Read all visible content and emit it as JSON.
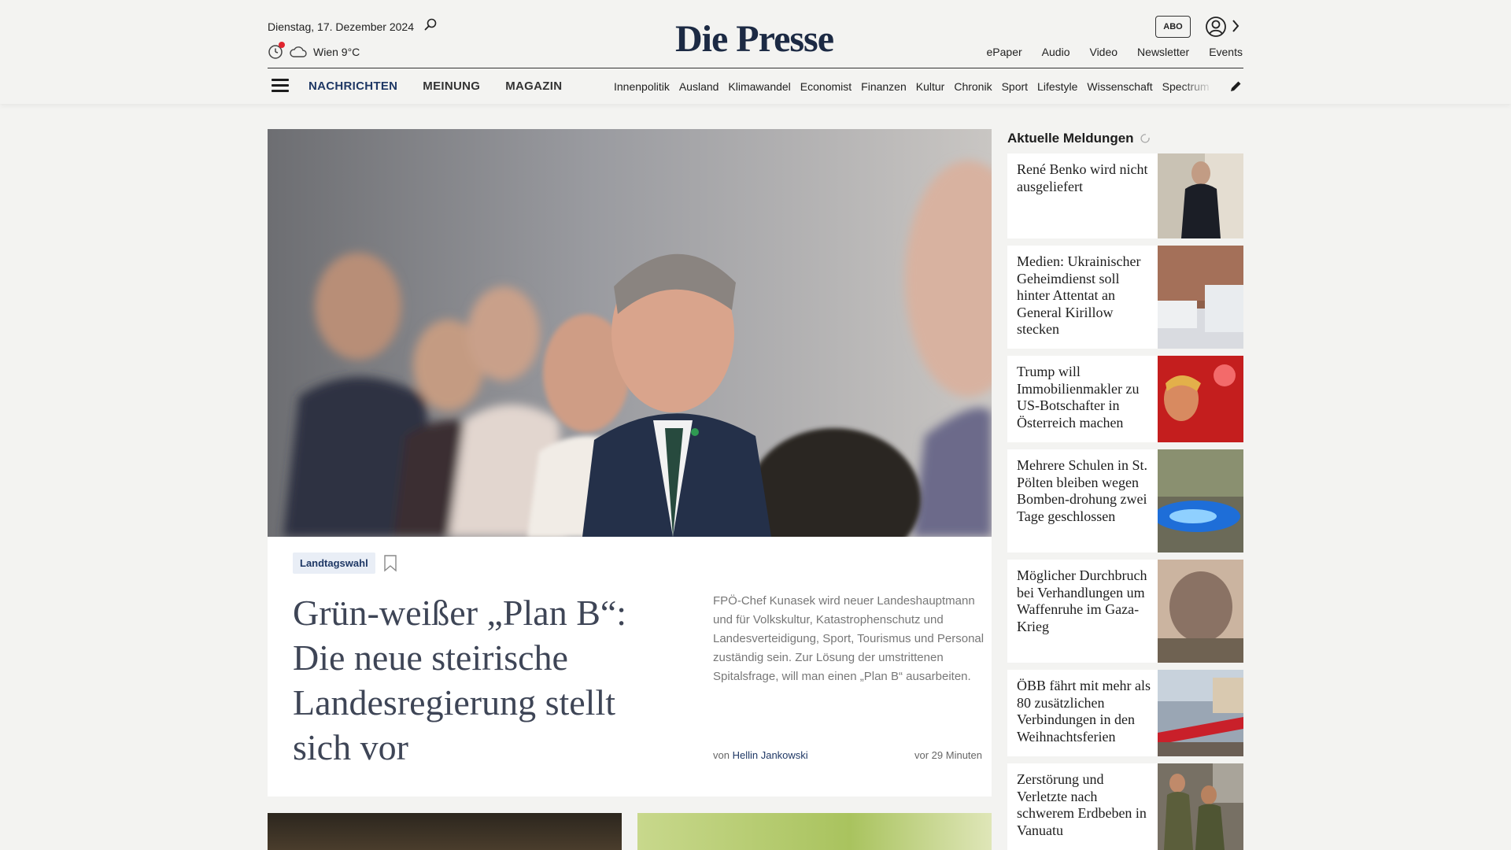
{
  "header": {
    "date": "Dienstag, 17. Dezember 2024",
    "weather": "Wien 9°C",
    "logo": "Die Presse",
    "abo_label": "ABO",
    "top_links": [
      "ePaper",
      "Audio",
      "Video",
      "Newsletter",
      "Events"
    ]
  },
  "nav": {
    "main": [
      "NACHRICHTEN",
      "MEINUNG",
      "MAGAZIN"
    ],
    "sub": [
      "Innenpolitik",
      "Ausland",
      "Klimawandel",
      "Economist",
      "Finanzen",
      "Kultur",
      "Chronik",
      "Sport",
      "Lifestyle",
      "Wissenschaft",
      "Spectrum"
    ]
  },
  "hero": {
    "tag": "Landtagswahl",
    "headline": "Grün-weißer „Plan B“: Die neue steirische Landesregierung stellt sich vor",
    "teaser": "FPÖ-Chef Kunasek wird neuer Landeshauptmann und für Volkskultur, Katastrophenschutz und Landesverteidigung, Sport, Tourismus und Personal zuständig sein. Zur Lösung der umstrittenen Spitalsfrage, will man einen „Plan B“ ausarbeiten.",
    "byline_prefix": "von",
    "author": "Hellin Jankowski",
    "time": "vor 29 Minuten"
  },
  "sidebar": {
    "title": "Aktuelle Meldungen",
    "items": [
      {
        "title": "René Benko wird nicht ausgeliefert"
      },
      {
        "title": "Medien: Ukrainischer Geheimdienst soll hinter Attentat an General Kirillow stecken"
      },
      {
        "title": "Trump will Immobilienmakler zu US-Botschafter in Österreich machen"
      },
      {
        "title": "Mehrere Schulen in St. Pölten bleiben wegen Bomben-drohung zwei Tage geschlossen"
      },
      {
        "title": "Möglicher Durchbruch bei Verhandlungen um Waffenruhe im Gaza-Krieg"
      },
      {
        "title": "ÖBB fährt mit mehr als 80 zusätzlichen Verbindungen in den Weihnachtsferien"
      },
      {
        "title": "Zerstörung und Verletzte nach schwerem Erdbeben in Vanuatu"
      }
    ]
  },
  "colors": {
    "brand_navy": "#1c2a44",
    "link_blue": "#1f3865",
    "notification_red": "#e0252f",
    "page_bg": "#f3f3f1"
  }
}
